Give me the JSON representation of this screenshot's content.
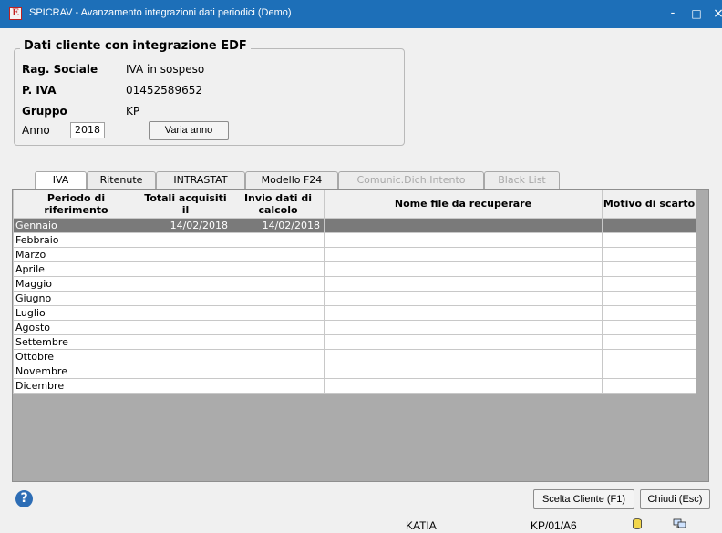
{
  "window": {
    "title": "SPICRAV - Avanzamento integrazioni dati periodici (Demo)",
    "app_icon_glyph": "E",
    "controls": {
      "minimize": "-",
      "maximize": "□",
      "close": "×"
    }
  },
  "client": {
    "legend": "Dati cliente con integrazione EDF",
    "rag_sociale_label": "Rag. Sociale",
    "rag_sociale_value": "IVA in sospeso",
    "piva_label": "P. IVA",
    "piva_value": "01452589652",
    "gruppo_label": "Gruppo",
    "gruppo_value": "KP",
    "anno_label": "Anno",
    "anno_value": "2018",
    "varia_anno_button": "Varia anno"
  },
  "tabs": [
    {
      "label": "IVA",
      "active": true,
      "disabled": false
    },
    {
      "label": "Ritenute",
      "active": false,
      "disabled": false
    },
    {
      "label": "INTRASTAT",
      "active": false,
      "disabled": false
    },
    {
      "label": "Modello F24",
      "active": false,
      "disabled": false
    },
    {
      "label": "Comunic.Dich.Intento",
      "active": false,
      "disabled": true
    },
    {
      "label": "Black List",
      "active": false,
      "disabled": true
    }
  ],
  "grid": {
    "headers": [
      "Periodo di riferimento",
      "Totali acquisiti il",
      "Invio dati di calcolo",
      "Nome file da recuperare",
      "Motivo di scarto"
    ],
    "rows": [
      {
        "periodo": "Gennaio",
        "totali": "14/02/2018",
        "invio": "14/02/2018",
        "nome_file": "",
        "motivo": "",
        "selected": true
      },
      {
        "periodo": "Febbraio",
        "totali": "",
        "invio": "",
        "nome_file": "",
        "motivo": ""
      },
      {
        "periodo": "Marzo",
        "totali": "",
        "invio": "",
        "nome_file": "",
        "motivo": ""
      },
      {
        "periodo": "Aprile",
        "totali": "",
        "invio": "",
        "nome_file": "",
        "motivo": ""
      },
      {
        "periodo": "Maggio",
        "totali": "",
        "invio": "",
        "nome_file": "",
        "motivo": ""
      },
      {
        "periodo": "Giugno",
        "totali": "",
        "invio": "",
        "nome_file": "",
        "motivo": ""
      },
      {
        "periodo": "Luglio",
        "totali": "",
        "invio": "",
        "nome_file": "",
        "motivo": ""
      },
      {
        "periodo": "Agosto",
        "totali": "",
        "invio": "",
        "nome_file": "",
        "motivo": ""
      },
      {
        "periodo": "Settembre",
        "totali": "",
        "invio": "",
        "nome_file": "",
        "motivo": ""
      },
      {
        "periodo": "Ottobre",
        "totali": "",
        "invio": "",
        "nome_file": "",
        "motivo": ""
      },
      {
        "periodo": "Novembre",
        "totali": "",
        "invio": "",
        "nome_file": "",
        "motivo": ""
      },
      {
        "periodo": "Dicembre",
        "totali": "",
        "invio": "",
        "nome_file": "",
        "motivo": ""
      }
    ]
  },
  "footer": {
    "help_glyph": "?",
    "scelta_cliente_button": "Scelta Cliente (F1)",
    "chiudi_button": "Chiudi (Esc)"
  },
  "status_bar": {
    "user": "KATIA",
    "code": "KP/01/A6",
    "database_icon": "database-icon",
    "network_icon": "network-icon"
  },
  "colors": {
    "titlebar": "#1d6fb8",
    "selected_row": "#7a7a7a",
    "grid_empty_area": "#ababab",
    "help_icon": "#2d6db5"
  }
}
